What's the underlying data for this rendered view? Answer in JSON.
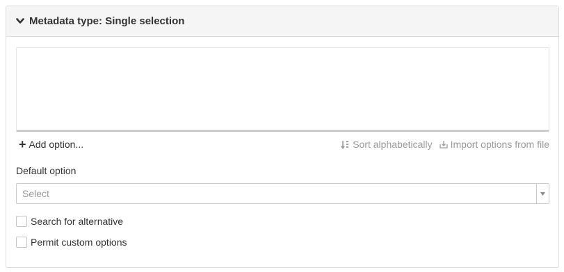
{
  "panel": {
    "title": "Metadata type: Single selection",
    "expand_icon": "chevron-down-icon"
  },
  "options": {
    "items": [],
    "add_label": "Add option...",
    "sort_label": "Sort alphabetically",
    "sort_icon": "sort-icon",
    "import_label": "Import options from file",
    "import_icon": "import-icon"
  },
  "default_option": {
    "label": "Default option",
    "placeholder": "Select"
  },
  "checkboxes": [
    {
      "label": "Search for alternative",
      "checked": false
    },
    {
      "label": "Permit custom options",
      "checked": false
    }
  ],
  "colors": {
    "header_bg": "#f5f5f5",
    "border": "#dddddd",
    "muted_text": "#999999",
    "text": "#333333"
  }
}
